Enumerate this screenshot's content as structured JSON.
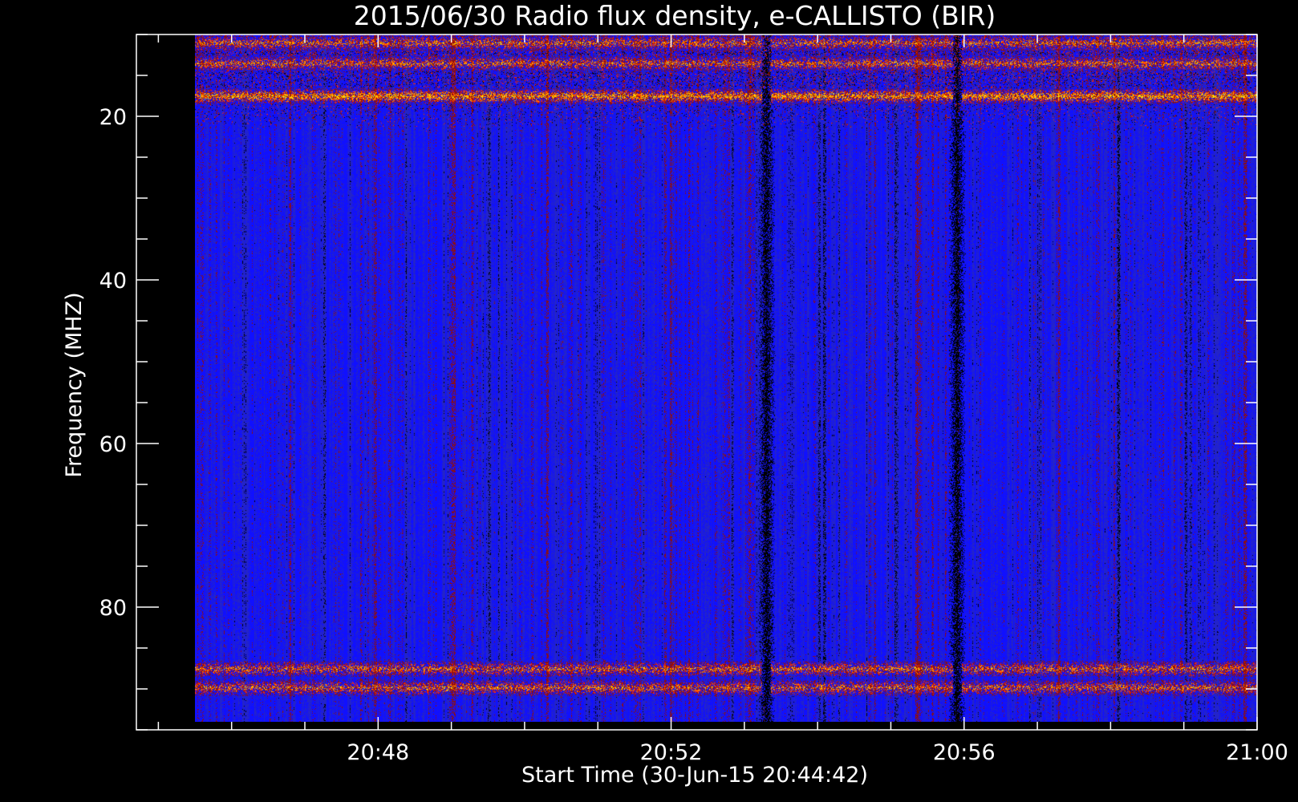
{
  "chart_data": {
    "type": "heatmap",
    "title": "2015/06/30  Radio flux density, e-CALLISTO (BIR)",
    "xlabel": "Start Time (30-Jun-15 20:44:42)",
    "ylabel": "Frequency (MHZ)",
    "x_ticks": [
      {
        "label": "20:48",
        "minutes": 48
      },
      {
        "label": "20:52",
        "minutes": 52
      },
      {
        "label": "20:56",
        "minutes": 56
      },
      {
        "label": "21:00",
        "minutes": 60
      }
    ],
    "y_ticks": [
      {
        "label": "20",
        "value": 20
      },
      {
        "label": "40",
        "value": 40
      },
      {
        "label": "60",
        "value": 60
      },
      {
        "label": "80",
        "value": 80
      }
    ],
    "x_range_minutes": [
      44.7,
      60.0
    ],
    "y_range_mhz": [
      10.0,
      95.0
    ],
    "data_start_minutes": 45.5,
    "data_end_minutes": 60.0,
    "freq_min_mhz": 10.0,
    "freq_max_mhz": 94.0,
    "colormap": [
      "#000000",
      "#2424c8",
      "#1010ff",
      "#8c1010",
      "#ff2a00",
      "#ff9000",
      "#ffe000"
    ],
    "background_color": "#000000",
    "frame_color": "#ffffff",
    "intense_bands": [
      {
        "freq_mhz": 11.0,
        "level": "high"
      },
      {
        "freq_mhz": 13.5,
        "level": "high"
      },
      {
        "freq_mhz": 17.5,
        "level": "very high"
      },
      {
        "freq_mhz": 87.5,
        "level": "high"
      },
      {
        "freq_mhz": 89.8,
        "level": "high"
      }
    ],
    "dark_columns_minutes": [
      53.3,
      55.9
    ]
  }
}
